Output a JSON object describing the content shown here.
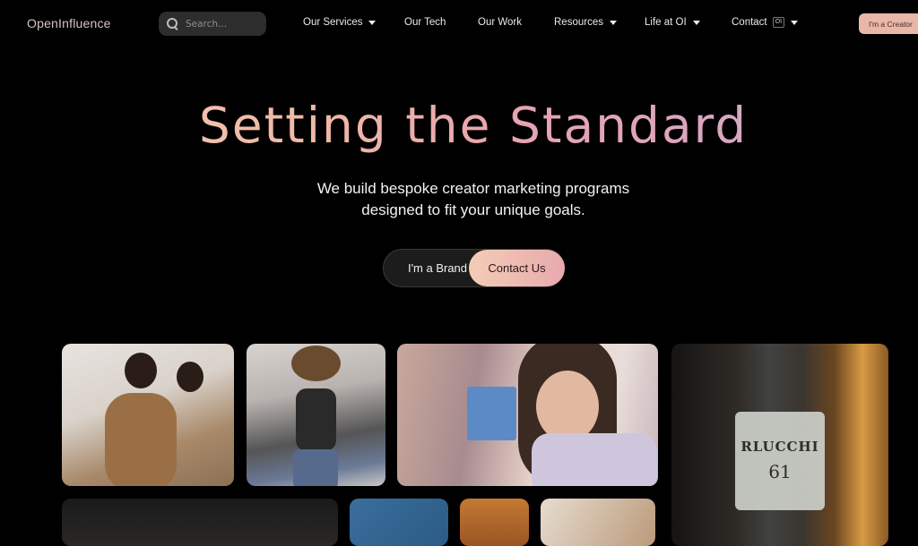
{
  "brand": {
    "logo_text": "OpenInfluence"
  },
  "search": {
    "placeholder": "Search..."
  },
  "nav": {
    "items": [
      {
        "label": "Our Services",
        "has_dropdown": true
      },
      {
        "label": "Our Tech",
        "has_dropdown": false
      },
      {
        "label": "Our Work",
        "has_dropdown": false
      },
      {
        "label": "Resources",
        "has_dropdown": true
      },
      {
        "label": "Life at OI",
        "has_dropdown": true
      },
      {
        "label": "Contact",
        "has_dropdown": true,
        "badge": "OI"
      }
    ],
    "creator_button": "I'm a Creator"
  },
  "hero": {
    "title": "Setting the Standard",
    "subtitle_line1": "We build bespoke creator marketing programs",
    "subtitle_line2": "designed to fit your unique goals.",
    "cta_brand": "I'm a Brand",
    "cta_contact": "Contact Us"
  },
  "gallery": {
    "bottle_label_text": "RLUCCHI",
    "bottle_label_num": "61"
  },
  "colors": {
    "background": "#000000",
    "accent_peach": "#f3cdb6",
    "accent_pink": "#e8a9ae",
    "accent_lavender": "#cdb0d3"
  }
}
